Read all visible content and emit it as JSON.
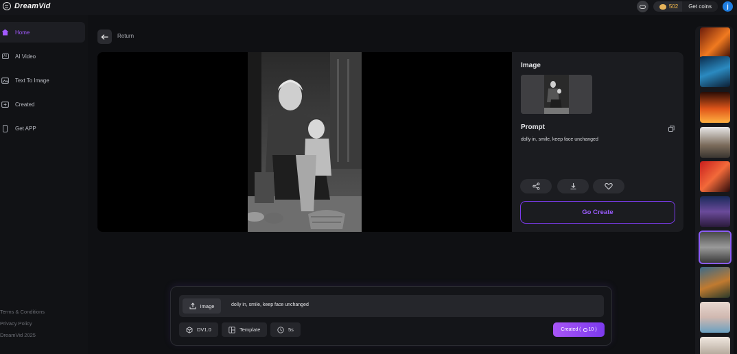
{
  "app": {
    "brand": "DreamVid"
  },
  "topbar": {
    "coins": "502",
    "get_coins_label": "Get coins",
    "avatar_initial": "j",
    "icons": {
      "community": "discord-icon",
      "coin": "coin-icon"
    }
  },
  "sidebar": {
    "items": [
      {
        "label": "Home",
        "icon": "home-icon",
        "active": true
      },
      {
        "label": "AI Video",
        "icon": "ai-video-icon",
        "active": false
      },
      {
        "label": "Text To Image",
        "icon": "image-icon",
        "active": false
      },
      {
        "label": "Created",
        "icon": "created-icon",
        "active": false
      },
      {
        "label": "Get APP",
        "icon": "phone-icon",
        "active": false
      }
    ],
    "footer": [
      "Terms & Conditions",
      "Privacy Policy",
      "DreamVid 2025"
    ]
  },
  "nav": {
    "return_label": "Return"
  },
  "detail": {
    "image_heading": "Image",
    "prompt_heading": "Prompt",
    "prompt_text": "dolly in, smile, keep face unchanged",
    "actions": [
      "share-icon",
      "download-icon",
      "heart-icon"
    ],
    "go_create_label": "Go Create"
  },
  "composer": {
    "image_label": "Image",
    "prompt_value": "dolly in,  smile, keep face unchanged",
    "model_label": "DV1.0",
    "template_label": "Template",
    "duration_label": "5s",
    "create_label": "Created (",
    "create_cost": "10",
    "create_label_end": ")"
  },
  "rail": {
    "selected_index": 6,
    "count": 10
  },
  "colors": {
    "accent": "#a259ff",
    "brand_gradient_start": "#a855f7",
    "brand_gradient_end": "#7c3aed",
    "coins": "#f2b84b",
    "background": "#0f1013"
  }
}
